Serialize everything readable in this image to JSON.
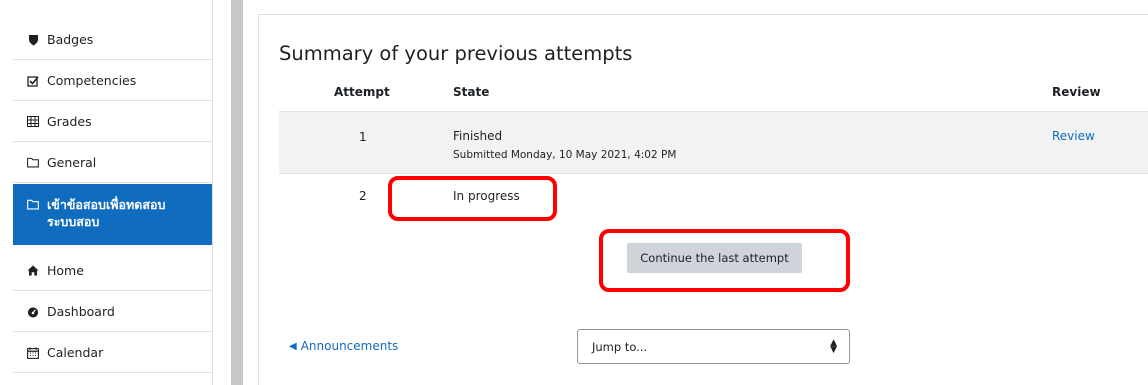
{
  "sidebar": {
    "items": [
      {
        "label": "Badges",
        "icon": "shield-icon"
      },
      {
        "label": "Competencies",
        "icon": "checkbox-icon"
      },
      {
        "label": "Grades",
        "icon": "table-icon"
      },
      {
        "label": "General",
        "icon": "folder-icon"
      },
      {
        "label": "เข้าข้อสอบเพื่อทดสอบ\nระบบสอบ",
        "icon": "folder-icon",
        "active": true
      },
      {
        "label": "Home",
        "icon": "home-icon"
      },
      {
        "label": "Dashboard",
        "icon": "dashboard-icon"
      },
      {
        "label": "Calendar",
        "icon": "calendar-icon"
      }
    ]
  },
  "main": {
    "heading": "Summary of your previous attempts",
    "table": {
      "headers": {
        "attempt": "Attempt",
        "state": "State",
        "review": "Review"
      },
      "rows": [
        {
          "attempt": "1",
          "state": "Finished",
          "submitted": "Submitted Monday, 10 May 2021, 4:02 PM",
          "review": "Review"
        },
        {
          "attempt": "2",
          "state": "In progress",
          "submitted": "",
          "review": ""
        }
      ]
    },
    "continue_button": "Continue the last attempt",
    "prev_activity": "Announcements",
    "jump_to": "Jump to..."
  },
  "colors": {
    "accent": "#0f6cbf",
    "highlight": "#ff0000",
    "button_bg": "#ced4da"
  }
}
